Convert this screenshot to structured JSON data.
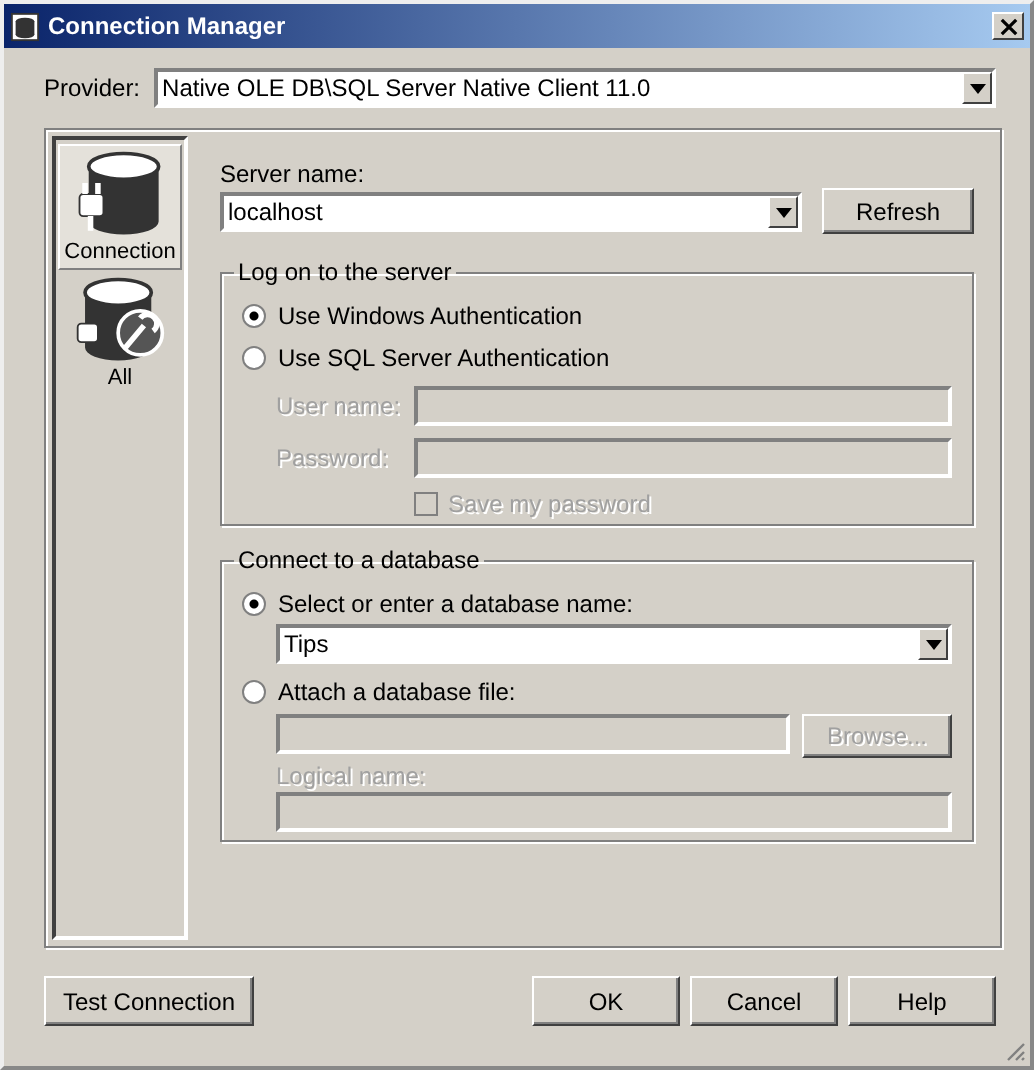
{
  "window": {
    "title": "Connection Manager"
  },
  "provider": {
    "label": "Provider:",
    "value": "Native OLE DB\\SQL Server Native Client 11.0"
  },
  "sidebar": {
    "items": [
      {
        "label": "Connection",
        "kind": "connection",
        "selected": true
      },
      {
        "label": "All",
        "kind": "all",
        "selected": false
      }
    ]
  },
  "server": {
    "label": "Server name:",
    "value": "localhost",
    "refresh": "Refresh"
  },
  "logon": {
    "title": "Log on to the server",
    "options": [
      {
        "label": "Use Windows Authentication",
        "selected": true
      },
      {
        "label": "Use SQL Server Authentication",
        "selected": false
      }
    ],
    "credentials_disabled": true,
    "user_label": "User name:",
    "password_label": "Password:",
    "save_password": {
      "label": "Save my password",
      "checked": false
    }
  },
  "database": {
    "title": "Connect to a database",
    "options": [
      {
        "label": "Select or enter a database name:",
        "selected": true
      },
      {
        "label": "Attach a database file:",
        "selected": false
      }
    ],
    "db_name": "Tips",
    "file_disabled": true,
    "browse": "Browse...",
    "logical_label": "Logical name:"
  },
  "buttons": {
    "test": "Test Connection",
    "ok": "OK",
    "cancel": "Cancel",
    "help": "Help"
  }
}
